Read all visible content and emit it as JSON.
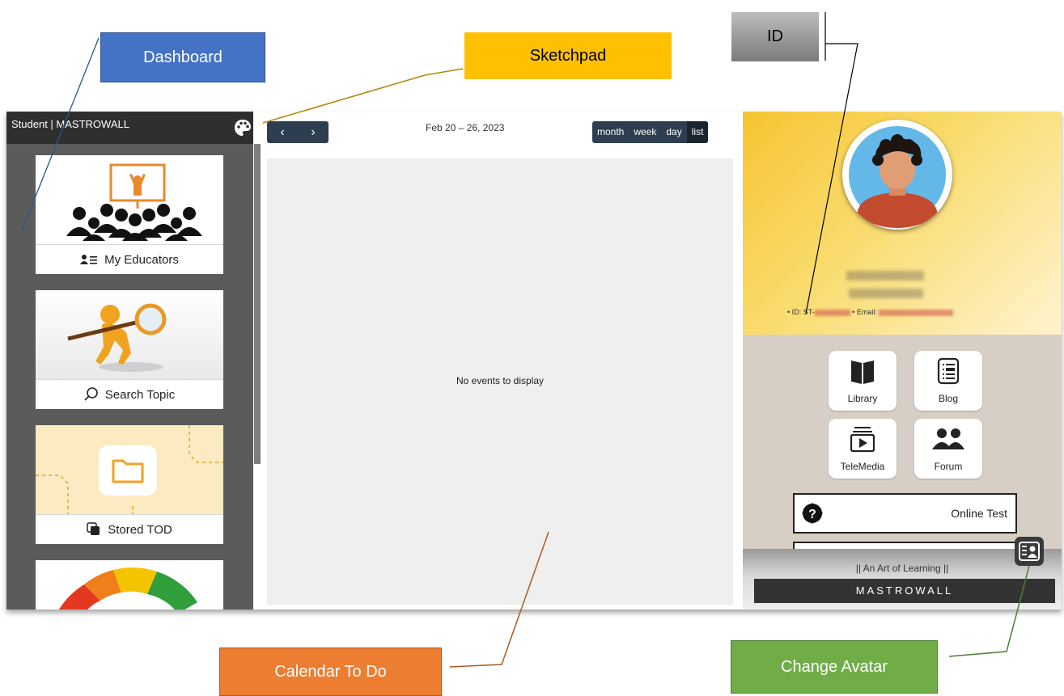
{
  "annotations": {
    "dashboard": "Dashboard",
    "sketchpad": "Sketchpad",
    "id": "ID",
    "calendar_todo": "Calendar To Do",
    "change_avatar": "Change Avatar"
  },
  "sidebar": {
    "header": "Student | MASTROWALL",
    "cards": [
      {
        "label": "My Educators",
        "icon": "educators-icon"
      },
      {
        "label": "Search Topic",
        "icon": "search-icon"
      },
      {
        "label": "Stored TOD",
        "icon": "layers-icon"
      },
      {
        "label": "",
        "icon": "gauge-icon"
      }
    ]
  },
  "calendar": {
    "prev": "‹",
    "next": "›",
    "title": "Feb 20 – 26, 2023",
    "views": [
      "month",
      "week",
      "day",
      "list"
    ],
    "active_view": "list",
    "empty_message": "No events to display"
  },
  "profile": {
    "id_prefix": "• ID: ST-",
    "email_prefix": "• Email:"
  },
  "tiles": [
    {
      "label": "Library",
      "icon": "book-icon"
    },
    {
      "label": "Blog",
      "icon": "blog-icon"
    },
    {
      "label": "TeleMedia",
      "icon": "video-icon"
    },
    {
      "label": "Forum",
      "icon": "users-icon"
    }
  ],
  "online_test": {
    "label": "Online Test"
  },
  "footer": {
    "tagline": "|| An Art of Learning ||",
    "brand": "MASTROWALL"
  },
  "colors": {
    "dashboard": "#4472c4",
    "sketchpad": "#ffc000",
    "calendar": "#ed7d31",
    "avatar": "#70ad47",
    "nav": "#2c3e50"
  }
}
